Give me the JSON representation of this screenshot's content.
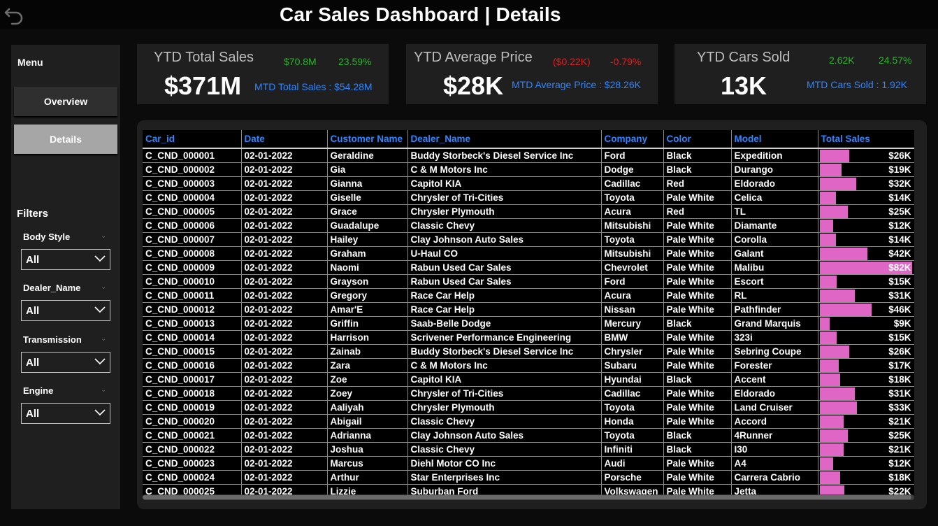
{
  "header": {
    "title": "Car Sales Dashboard | Details",
    "back_icon": "undo-arrow-icon"
  },
  "sidebar": {
    "menu_label": "Menu",
    "nav": [
      {
        "label": "Overview",
        "active": false
      },
      {
        "label": "Details",
        "active": true
      }
    ],
    "filters_label": "Filters",
    "filters": [
      {
        "label": "Body Style",
        "value": "All"
      },
      {
        "label": "Dealer_Name",
        "value": "All"
      },
      {
        "label": "Transmission",
        "value": "All"
      },
      {
        "label": "Engine",
        "value": "All"
      }
    ]
  },
  "kpis": [
    {
      "title": "YTD Total Sales",
      "value": "$371M",
      "delta": "$70.8M",
      "pct": "23.59%",
      "mtd": "MTD Total Sales : $54.28M",
      "trend": "up"
    },
    {
      "title": "YTD Average Price",
      "value": "$28K",
      "delta": "($0.22K)",
      "pct": "-0.79%",
      "mtd": "MTD Average Price : $28.26K",
      "trend": "down"
    },
    {
      "title": "YTD Cars Sold",
      "value": "13K",
      "delta": "2.62K",
      "pct": "24.57%",
      "mtd": "MTD Cars Sold : 1.92K",
      "trend": "up"
    }
  ],
  "colors": {
    "up": "#2bb42b",
    "down": "#e02020",
    "accent": "#2f86ff",
    "bar": "#e066c6"
  },
  "table": {
    "columns": [
      "Car_id",
      "Date",
      "Customer Name",
      "Dealer_Name",
      "Company",
      "Color",
      "Model",
      "Total Sales"
    ],
    "bar_max_sales_k": 82,
    "rows": [
      [
        "C_CND_000001",
        "02-01-2022",
        "Geraldine",
        "Buddy Storbeck's Diesel Service Inc",
        "Ford",
        "Black",
        "Expedition",
        "$26K",
        26
      ],
      [
        "C_CND_000002",
        "02-01-2022",
        "Gia",
        "C & M Motors Inc",
        "Dodge",
        "Black",
        "Durango",
        "$19K",
        19
      ],
      [
        "C_CND_000003",
        "02-01-2022",
        "Gianna",
        "Capitol KIA",
        "Cadillac",
        "Red",
        "Eldorado",
        "$32K",
        32
      ],
      [
        "C_CND_000004",
        "02-01-2022",
        "Giselle",
        "Chrysler of Tri-Cities",
        "Toyota",
        "Pale White",
        "Celica",
        "$14K",
        14
      ],
      [
        "C_CND_000005",
        "02-01-2022",
        "Grace",
        "Chrysler Plymouth",
        "Acura",
        "Red",
        "TL",
        "$25K",
        25
      ],
      [
        "C_CND_000006",
        "02-01-2022",
        "Guadalupe",
        "Classic Chevy",
        "Mitsubishi",
        "Pale White",
        "Diamante",
        "$12K",
        12
      ],
      [
        "C_CND_000007",
        "02-01-2022",
        "Hailey",
        "Clay Johnson Auto Sales",
        "Toyota",
        "Pale White",
        "Corolla",
        "$14K",
        14
      ],
      [
        "C_CND_000008",
        "02-01-2022",
        "Graham",
        "U-Haul CO",
        "Mitsubishi",
        "Pale White",
        "Galant",
        "$42K",
        42
      ],
      [
        "C_CND_000009",
        "02-01-2022",
        "Naomi",
        "Rabun Used Car Sales",
        "Chevrolet",
        "Pale White",
        "Malibu",
        "$82K",
        82
      ],
      [
        "C_CND_000010",
        "02-01-2022",
        "Grayson",
        "Rabun Used Car Sales",
        "Ford",
        "Pale White",
        "Escort",
        "$15K",
        15
      ],
      [
        "C_CND_000011",
        "02-01-2022",
        "Gregory",
        "Race Car Help",
        "Acura",
        "Pale White",
        "RL",
        "$31K",
        31
      ],
      [
        "C_CND_000012",
        "02-01-2022",
        "Amar'E",
        "Race Car Help",
        "Nissan",
        "Pale White",
        "Pathfinder",
        "$46K",
        46
      ],
      [
        "C_CND_000013",
        "02-01-2022",
        "Griffin",
        "Saab-Belle Dodge",
        "Mercury",
        "Black",
        "Grand Marquis",
        "$9K",
        9
      ],
      [
        "C_CND_000014",
        "02-01-2022",
        "Harrison",
        "Scrivener Performance Engineering",
        "BMW",
        "Pale White",
        "323i",
        "$15K",
        15
      ],
      [
        "C_CND_000015",
        "02-01-2022",
        "Zainab",
        "Buddy Storbeck's Diesel Service Inc",
        "Chrysler",
        "Pale White",
        "Sebring Coupe",
        "$26K",
        26
      ],
      [
        "C_CND_000016",
        "02-01-2022",
        "Zara",
        "C & M Motors Inc",
        "Subaru",
        "Pale White",
        "Forester",
        "$17K",
        17
      ],
      [
        "C_CND_000017",
        "02-01-2022",
        "Zoe",
        "Capitol KIA",
        "Hyundai",
        "Black",
        "Accent",
        "$18K",
        18
      ],
      [
        "C_CND_000018",
        "02-01-2022",
        "Zoey",
        "Chrysler of Tri-Cities",
        "Cadillac",
        "Pale White",
        "Eldorado",
        "$31K",
        31
      ],
      [
        "C_CND_000019",
        "02-01-2022",
        "Aaliyah",
        "Chrysler Plymouth",
        "Toyota",
        "Pale White",
        "Land Cruiser",
        "$33K",
        33
      ],
      [
        "C_CND_000020",
        "02-01-2022",
        "Abigail",
        "Classic Chevy",
        "Honda",
        "Pale White",
        "Accord",
        "$21K",
        21
      ],
      [
        "C_CND_000021",
        "02-01-2022",
        "Adrianna",
        "Clay Johnson Auto Sales",
        "Toyota",
        "Black",
        "4Runner",
        "$25K",
        25
      ],
      [
        "C_CND_000022",
        "02-01-2022",
        "Joshua",
        "Classic Chevy",
        "Infiniti",
        "Black",
        "I30",
        "$21K",
        21
      ],
      [
        "C_CND_000023",
        "02-01-2022",
        "Marcus",
        "Diehl Motor CO Inc",
        "Audi",
        "Pale White",
        "A4",
        "$12K",
        12
      ],
      [
        "C_CND_000024",
        "02-01-2022",
        "Arthur",
        "Star Enterprises Inc",
        "Porsche",
        "Pale White",
        "Carrera Cabrio",
        "$18K",
        18
      ],
      [
        "C_CND_000025",
        "02-01-2022",
        "Lizzie",
        "Suburban Ford",
        "Volkswagen",
        "Pale White",
        "Jetta",
        "$22K",
        22
      ]
    ]
  }
}
